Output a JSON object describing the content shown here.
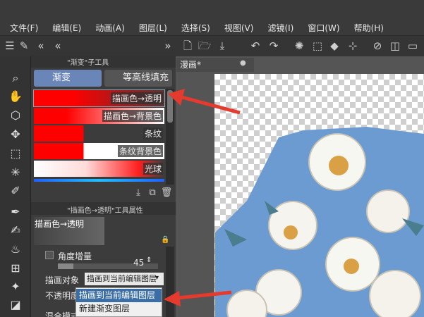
{
  "menu": [
    "文件(F)",
    "编辑(E)",
    "动画(A)",
    "图层(L)",
    "选择(S)",
    "视图(V)",
    "滤镜(I)",
    "窗口(W)",
    "帮助(H)"
  ],
  "subtool_panel": {
    "title": "\"渐变\"子工具",
    "tabs": [
      "渐变",
      "等高线填充"
    ],
    "presets": [
      {
        "label": "描画色→透明",
        "selected": true
      },
      {
        "label": "描画色→背景色",
        "selected": false
      },
      {
        "label": "条纹",
        "selected": false
      },
      {
        "label": "条纹背景色",
        "selected": false
      },
      {
        "label": "光球",
        "selected": false
      }
    ]
  },
  "tool_props": {
    "title": "\"描画色→透明\"工具属性",
    "preview_label": "描画色→透明",
    "angle_label": "角度增量",
    "angle_value": "45",
    "target_label": "描画对象",
    "target_value": "描画到当前编辑图层",
    "opacity_label": "不透明度",
    "blend_label": "混合模式",
    "dropdown_options": [
      "描画到当前编辑图层",
      "新建渐变图层"
    ]
  },
  "document": {
    "tab": "漫画*"
  },
  "colors": {
    "accent": "#6a86b8",
    "arrow": "#e53a2e",
    "canvas_blue": "#6b9bd1",
    "gradient_red": "#ff0000"
  }
}
